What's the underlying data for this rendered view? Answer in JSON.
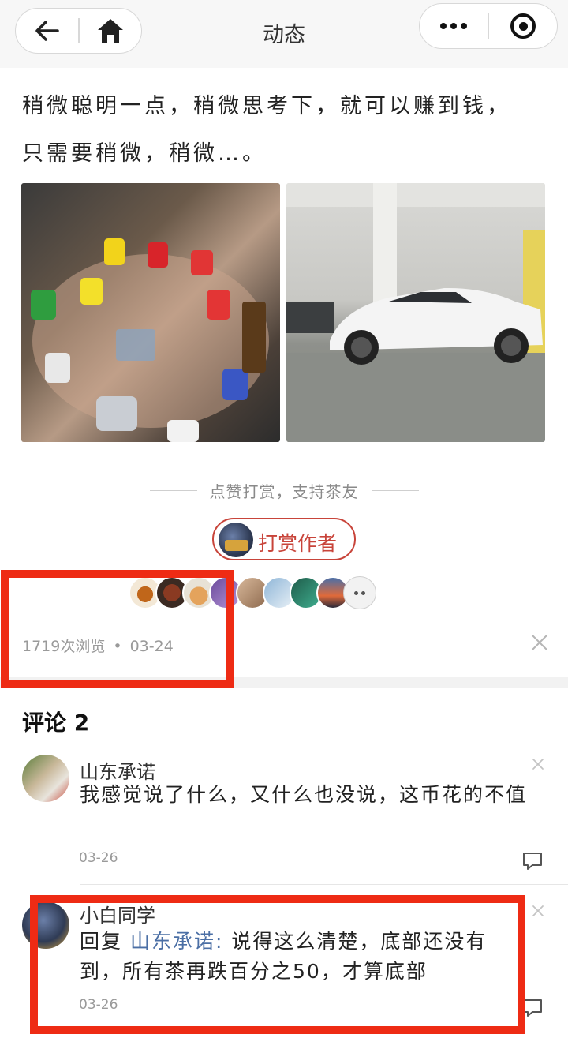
{
  "nav": {
    "title": "动态",
    "back_icon": "arrow-left-icon",
    "home_icon": "home-icon",
    "more_icon": "more-dots-icon",
    "target_icon": "target-circle-icon"
  },
  "post": {
    "line1": "稍微聪明一点，稍微思考下，就可以赚到钱，",
    "line2": "只需要稍微，稍微…。",
    "images": [
      {
        "subject": "hands-with-luxury-watches"
      },
      {
        "subject": "white-sports-car-in-garage"
      }
    ]
  },
  "support": {
    "label": "点赞打赏，支持茶友",
    "reward_button": "打赏作者",
    "avatar_count_shown": 9
  },
  "meta": {
    "views": "1719次浏览",
    "separator": "•",
    "date": "03-24"
  },
  "comments": {
    "title": "评论 2",
    "items": [
      {
        "name": "山东承诺",
        "text": "我感觉说了什么，又什么也没说，这币花的不值",
        "date": "03-26"
      },
      {
        "name": "小白同学",
        "reply_prefix": "回复 ",
        "reply_to": "山东承诺:",
        "text": " 说得这么清楚，底部还没有到，所有茶再跌百分之50，才算底部",
        "date": "03-26"
      }
    ]
  },
  "colors": {
    "accent_red": "#c8443a",
    "highlight_box": "#ee2b14",
    "link_blue": "#4b6fa5"
  }
}
